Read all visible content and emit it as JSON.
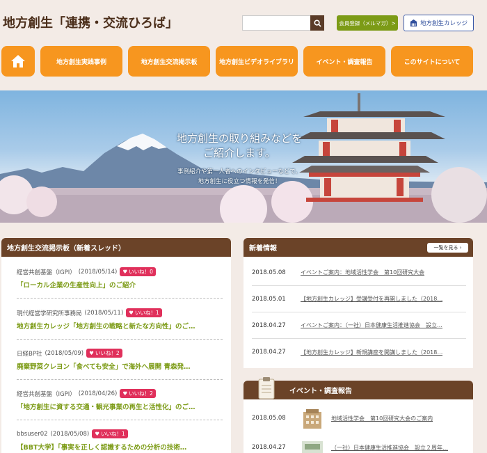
{
  "header": {
    "site_title": "地方創生「連携・交流ひろば」",
    "search_placeholder": "",
    "member_label": "会員登録（メルマガ）>",
    "college_label": "地方創生カレッジ"
  },
  "nav": {
    "home_icon": "house-icon",
    "items": [
      "地方創生実践事例",
      "地方創生交流掲示板",
      "地方創生ビデオライブラリ",
      "イベント・調査報告",
      "このサイトについて"
    ]
  },
  "hero": {
    "title_line1": "地方創生の取り組みなどを",
    "title_line2": "ご紹介します。",
    "sub_line1": "事例紹介や第一人者へのインタビューなどで、",
    "sub_line2": "地方創生に役立つ情報を発信！"
  },
  "board": {
    "title": "地方創生交流掲示板（新着スレッド）",
    "threads": [
      {
        "author": "経営共創基盤（IGPI）",
        "date": "(2018/05/14)",
        "like": "いいね！0",
        "title": "「ローカル企業の生産性向上」のご紹介"
      },
      {
        "author": "現代経営学研究所事務局",
        "date": "(2018/05/11)",
        "like": "いいね！1",
        "title": "地方創生カレッジ「地方創生の戦略と新たな方向性」のご…"
      },
      {
        "author": "日経BP社",
        "date": "(2018/05/09)",
        "like": "いいね！2",
        "title": "廃棄野菜クレヨン「食べても安全」で海外へ展開 青森発…"
      },
      {
        "author": "経営共創基盤（IGPI）",
        "date": "(2018/04/26)",
        "like": "いいね！2",
        "title": "「地方創生に資する交通・観光事業の再生と活性化」のご…"
      },
      {
        "author": "bbsuser02",
        "date": "(2018/05/08)",
        "like": "いいね！1",
        "title": "【BBT大学】「事実を正しく認識するための分析の技術…"
      }
    ]
  },
  "news": {
    "title": "新着情報",
    "more_label": "一覧を見る ›",
    "items": [
      {
        "date": "2018.05.08",
        "text": "イベントご案内：地域活性学会　第10回研究大会"
      },
      {
        "date": "2018.05.01",
        "text": "【地方創生カレッジ】受講受付を再開しました（2018…"
      },
      {
        "date": "2018.04.27",
        "text": "イベントご案内：（一社）日本健康生活推進協会　設立…"
      },
      {
        "date": "2018.04.27",
        "text": "【地方創生カレッジ】新規講座を開講しました（2018…"
      }
    ]
  },
  "events": {
    "title": "イベント・調査報告",
    "items": [
      {
        "date": "2018.05.08",
        "text": "地域活性学会　第10回研究大会のご案内"
      },
      {
        "date": "2018.04.27",
        "text": "（一社）日本健康生活推進協会　設立２周年…"
      }
    ]
  }
}
